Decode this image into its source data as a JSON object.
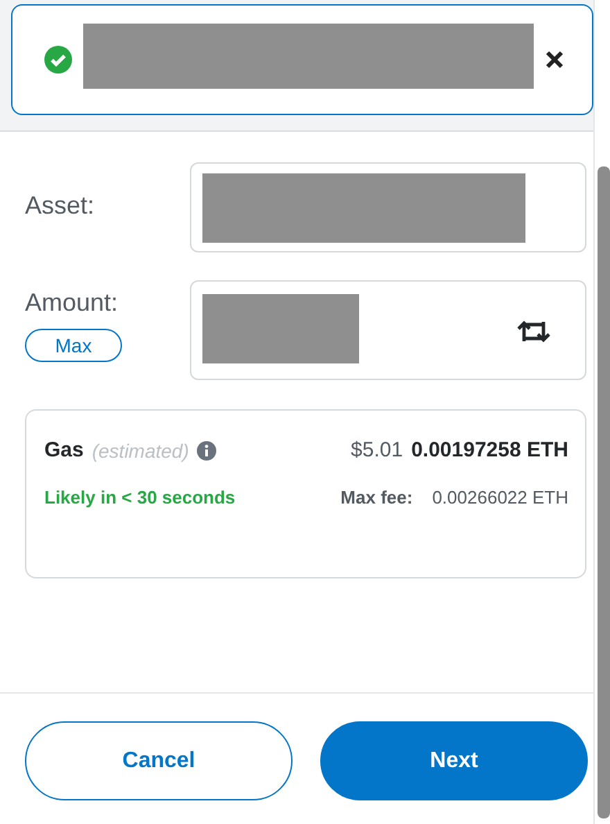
{
  "notification": {
    "kind": "success"
  },
  "asset": {
    "label": "Asset:"
  },
  "amount": {
    "label": "Amount:",
    "max_button": "Max"
  },
  "gas": {
    "label": "Gas",
    "qualifier": "(estimated)",
    "fiat": "$5.01",
    "amount": "0.00197258 ETH",
    "timing": "Likely in < 30 seconds",
    "max_fee_label": "Max fee:",
    "max_fee": "0.00266022 ETH"
  },
  "buttons": [
    {
      "label": "Cancel",
      "kind": "secondary"
    },
    {
      "label": "Next",
      "kind": "primary"
    }
  ]
}
